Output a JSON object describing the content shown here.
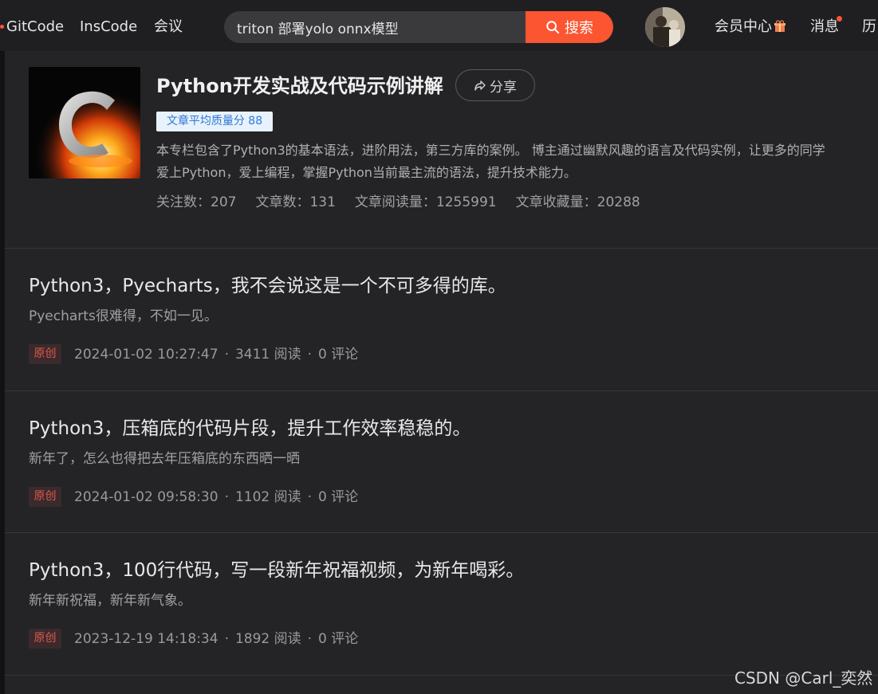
{
  "nav": {
    "links": [
      "GitCode",
      "InsCode",
      "会议"
    ],
    "search_value": "triton 部署yolo onnx模型",
    "search_button": "搜索",
    "vip": "会员中心",
    "messages": "消息",
    "history": "历"
  },
  "column": {
    "title": "Python开发实战及代码示例讲解",
    "share": "分享",
    "quality": "文章平均质量分 88",
    "description": "本专栏包含了Python3的基本语法，进阶用法，第三方库的案例。 博主通过幽默风趣的语言及代码实例，让更多的同学爱上Python，爱上编程，掌握Python当前最主流的语法，提升技术能力。",
    "stats": [
      "关注数：207",
      "文章数：131",
      "文章阅读量：1255991",
      "文章收藏量：20288"
    ]
  },
  "articles": [
    {
      "title": "Python3，Pyecharts，我不会说这是一个不可多得的库。",
      "desc": "Pyecharts很难得，不如一见。",
      "tag": "原创",
      "date": "2024-01-02 10:27:47",
      "reads": "3411 阅读",
      "comments": "0 评论"
    },
    {
      "title": "Python3，压箱底的代码片段，提升工作效率稳稳的。",
      "desc": "新年了，怎么也得把去年压箱底的东西晒一晒",
      "tag": "原创",
      "date": "2024-01-02 09:58:30",
      "reads": "1102 阅读",
      "comments": "0 评论"
    },
    {
      "title": "Python3，100行代码，写一段新年祝福视频，为新年喝彩。",
      "desc": "新年新祝福，新年新气象。",
      "tag": "原创",
      "date": "2023-12-19 14:18:34",
      "reads": "1892 阅读",
      "comments": "0 评论"
    }
  ],
  "meta_separator": "·",
  "watermark": "CSDN @Carl_奕然",
  "colors": {
    "accent": "#fc5531",
    "background": "#242427",
    "badge_text": "#2d7ad6"
  },
  "icons": {
    "search": "search-icon",
    "share": "share-icon",
    "gift": "gift-icon"
  }
}
